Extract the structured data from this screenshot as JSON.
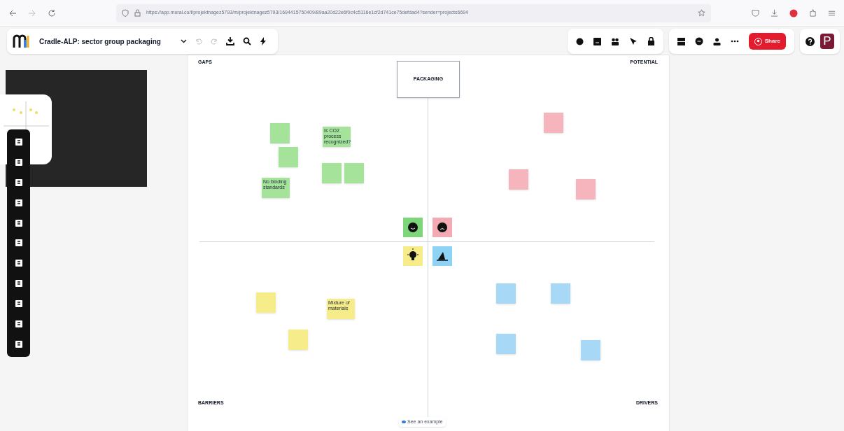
{
  "browser": {
    "url": "https://app.mural.co/t/projektnagez5793/m/projektnagez5793/1694415750409/89aa20d22e6f0c4c5116e1cf2d741ce75defdad4?sender=projects6694"
  },
  "toolbar": {
    "title": "Cradle-ALP: sector group packaging",
    "share": "Share",
    "avatar": "P"
  },
  "board": {
    "title": "PACKAGING",
    "quadrants": [
      "GAPS",
      "POTENTIAL",
      "BARRIERS",
      "DRIVERS"
    ],
    "example_button": "See an example"
  },
  "notes": [
    {
      "color": "#a6e39a"
    },
    {
      "color": "#a6e39a"
    },
    {
      "color": "#a6e39a",
      "text": "Is CO2 process recognized?"
    },
    {
      "color": "#a6e39a"
    },
    {
      "color": "#a6e39a"
    },
    {
      "color": "#a6e39a",
      "text": "No binding standards"
    },
    {
      "color": "#f6b5bd"
    },
    {
      "color": "#f6b5bd"
    },
    {
      "color": "#f6b5bd"
    },
    {
      "color": "#f6ec8a"
    },
    {
      "color": "#f6ec8a",
      "text": "Mixture of materials"
    },
    {
      "color": "#f6ec8a"
    },
    {
      "color": "#a7d8f5"
    },
    {
      "color": "#a7d8f5"
    },
    {
      "color": "#a7d8f5"
    },
    {
      "color": "#a7d8f5"
    }
  ],
  "stamps": [
    {
      "kind": "smile",
      "color": "#7ed67a"
    },
    {
      "kind": "frown",
      "color": "#f4aab3"
    },
    {
      "kind": "bulb",
      "color": "#f6ec8a"
    },
    {
      "kind": "fin",
      "color": "#8fd3f4"
    }
  ]
}
